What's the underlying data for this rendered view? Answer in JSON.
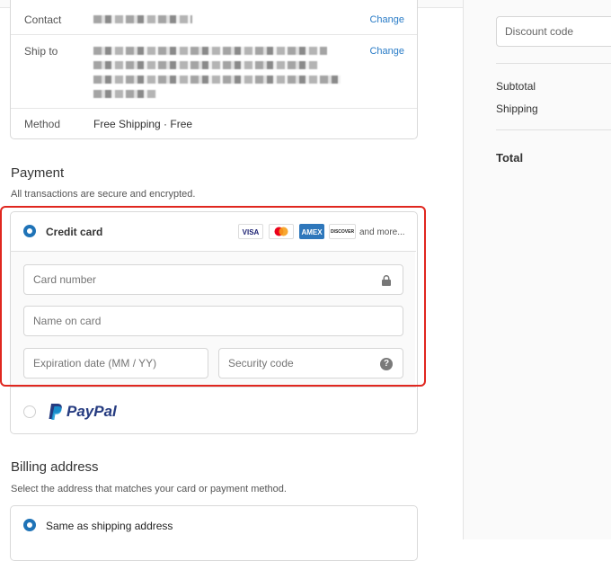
{
  "review": {
    "contact_label": "Contact",
    "contact_change": "Change",
    "ship_label": "Ship to",
    "ship_change": "Change",
    "method_label": "Method",
    "method_value": "Free Shipping · Free"
  },
  "payment": {
    "title": "Payment",
    "subtitle": "All transactions are secure and encrypted.",
    "credit_card_label": "Credit card",
    "card_brands": [
      "VISA",
      "",
      "AMEX",
      "DISCOVER"
    ],
    "and_more": "and more...",
    "card_number_placeholder": "Card number",
    "name_placeholder": "Name on card",
    "expiry_placeholder": "Expiration date (MM / YY)",
    "security_placeholder": "Security code",
    "help_glyph": "?",
    "paypal_logo": "PayPal"
  },
  "billing": {
    "title": "Billing address",
    "subtitle": "Select the address that matches your card or payment method.",
    "same_label": "Same as shipping address"
  },
  "summary": {
    "discount_placeholder": "Discount code",
    "subtotal_label": "Subtotal",
    "shipping_label": "Shipping",
    "total_label": "Total"
  },
  "colors": {
    "accent": "#1f73b7",
    "link": "#2a7cc7",
    "highlight": "#e0271f",
    "paypal_dark": "#253b80",
    "paypal_light": "#179bd7"
  }
}
